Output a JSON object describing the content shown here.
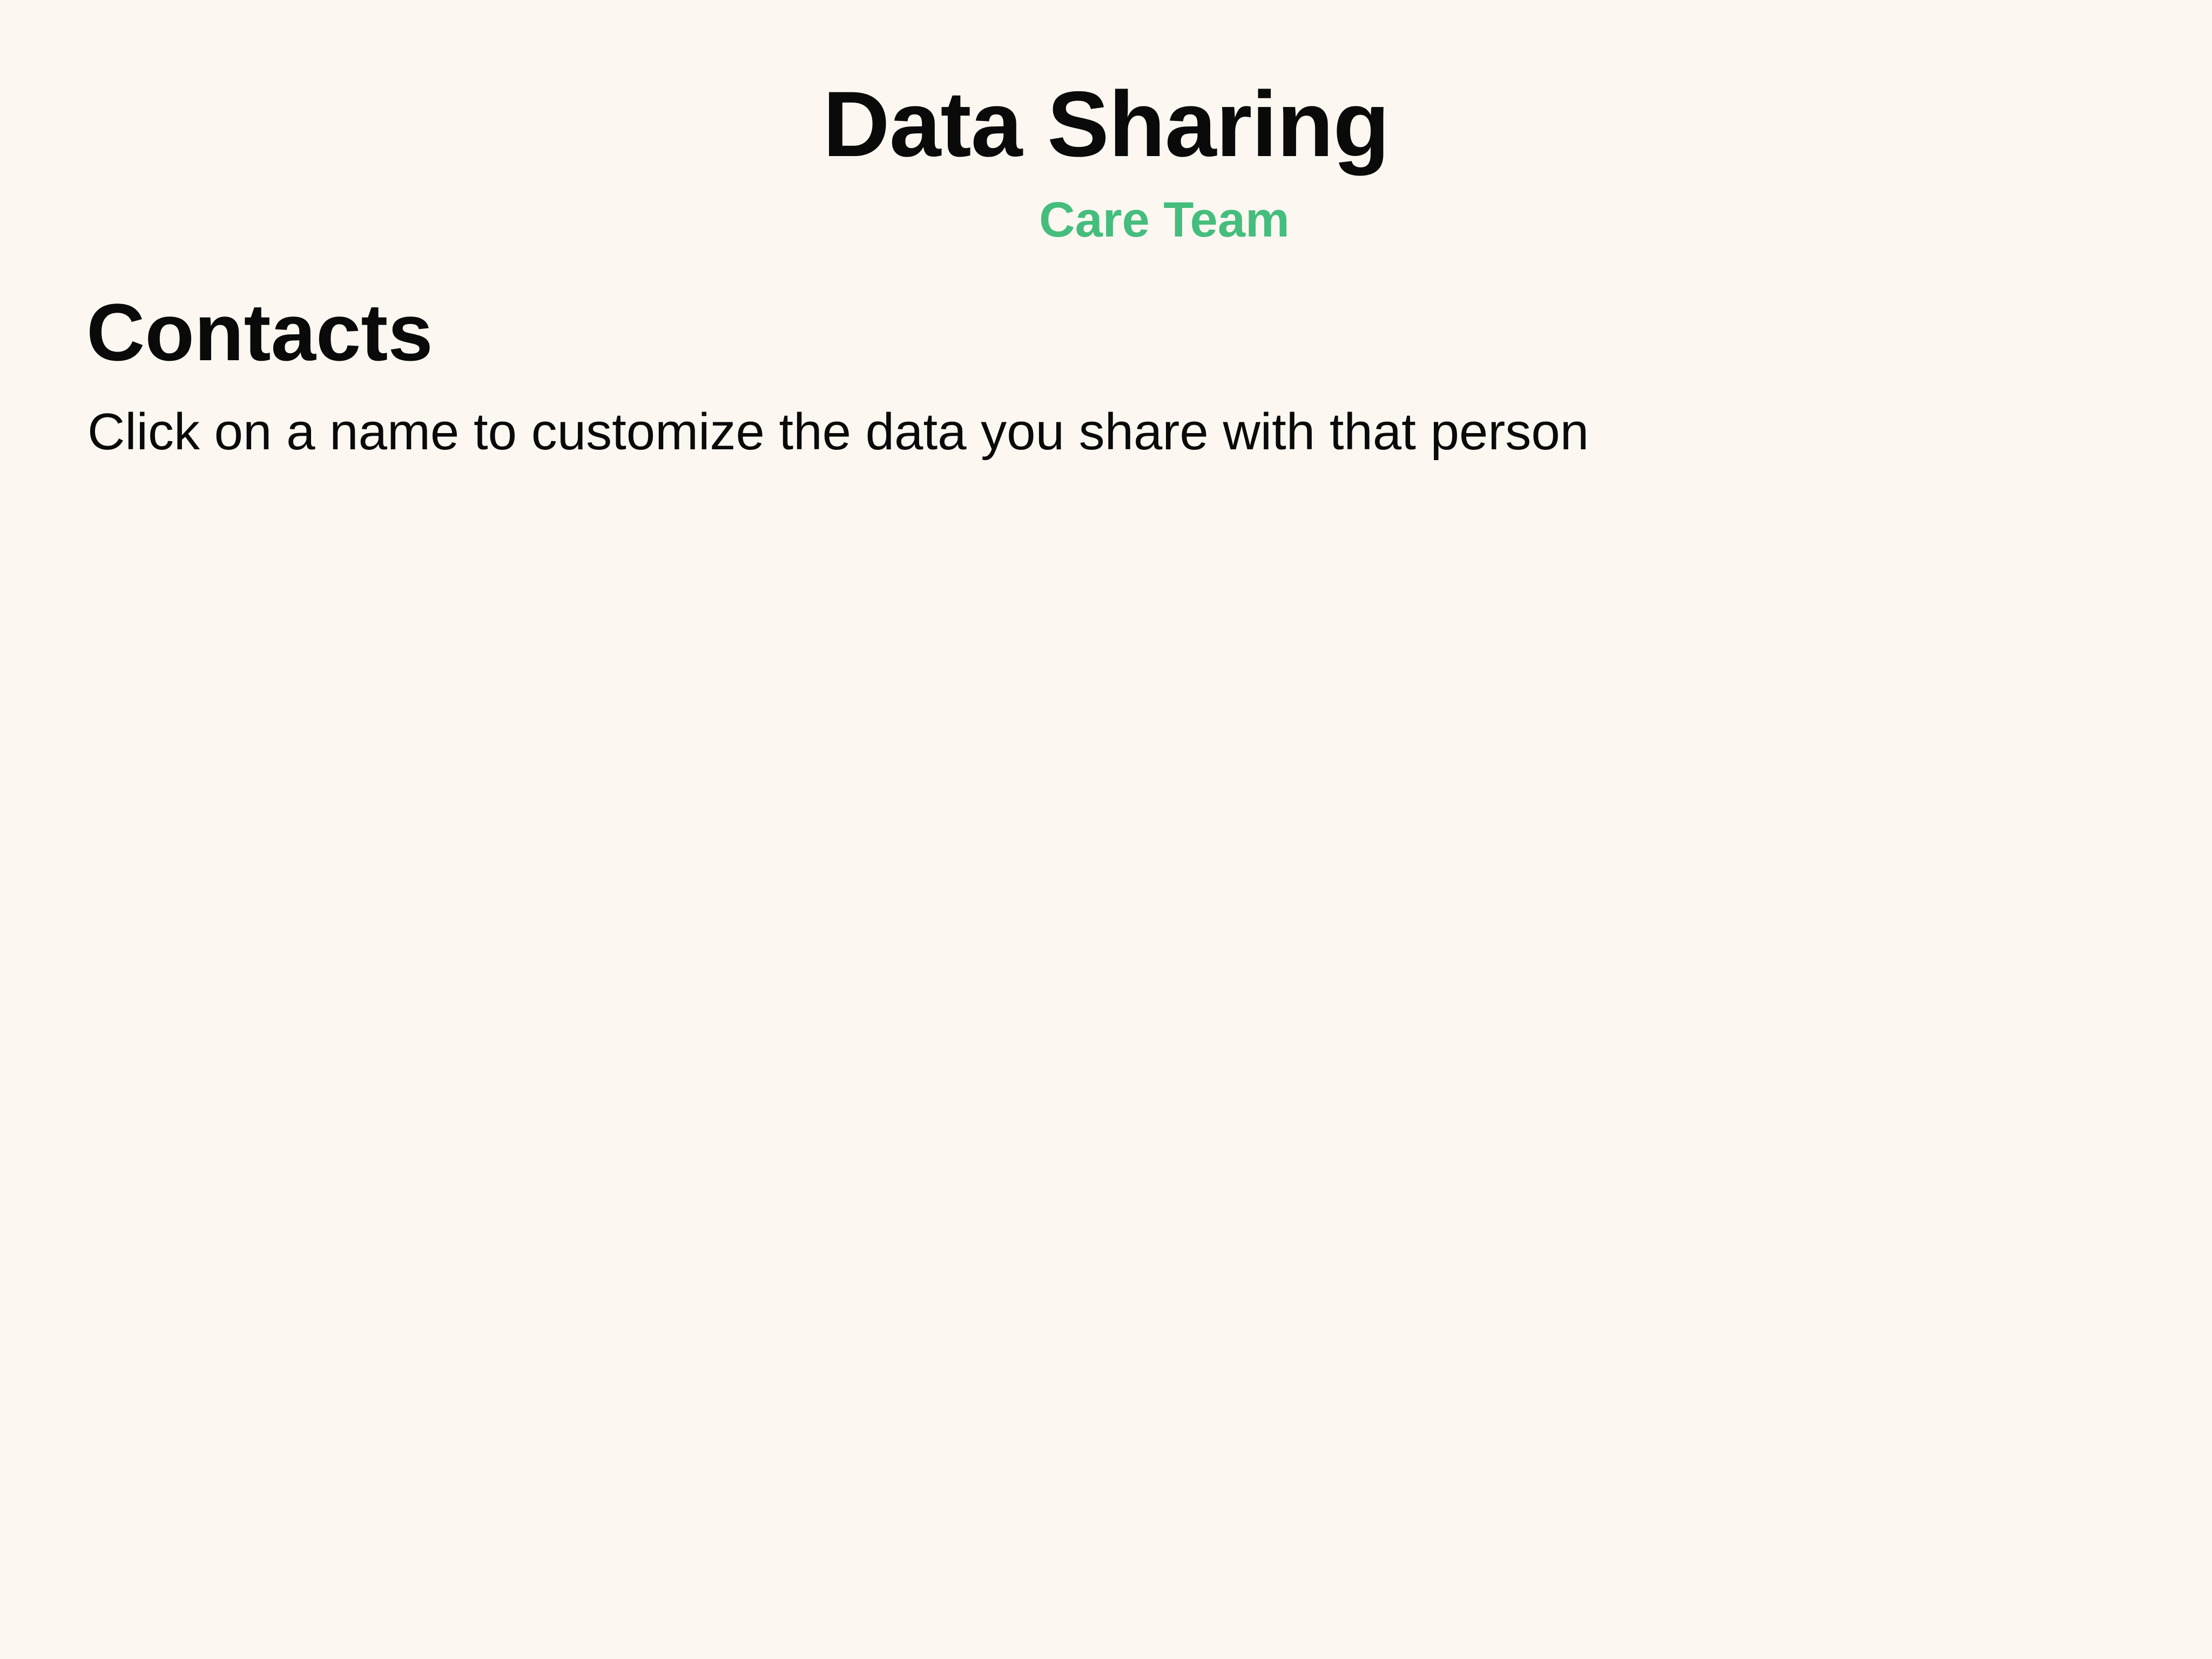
{
  "colors": {
    "background": "#fcf8f1",
    "accent": "#45bd7d",
    "text": "#0a0a0a"
  },
  "header": {
    "title": "Data Sharing",
    "care_team": {
      "label": "Care Team",
      "icon": "users-group-icon"
    }
  },
  "contacts": {
    "title": "Contacts",
    "subtitle": "Click on a name to customize the data you share with that person",
    "items": []
  }
}
